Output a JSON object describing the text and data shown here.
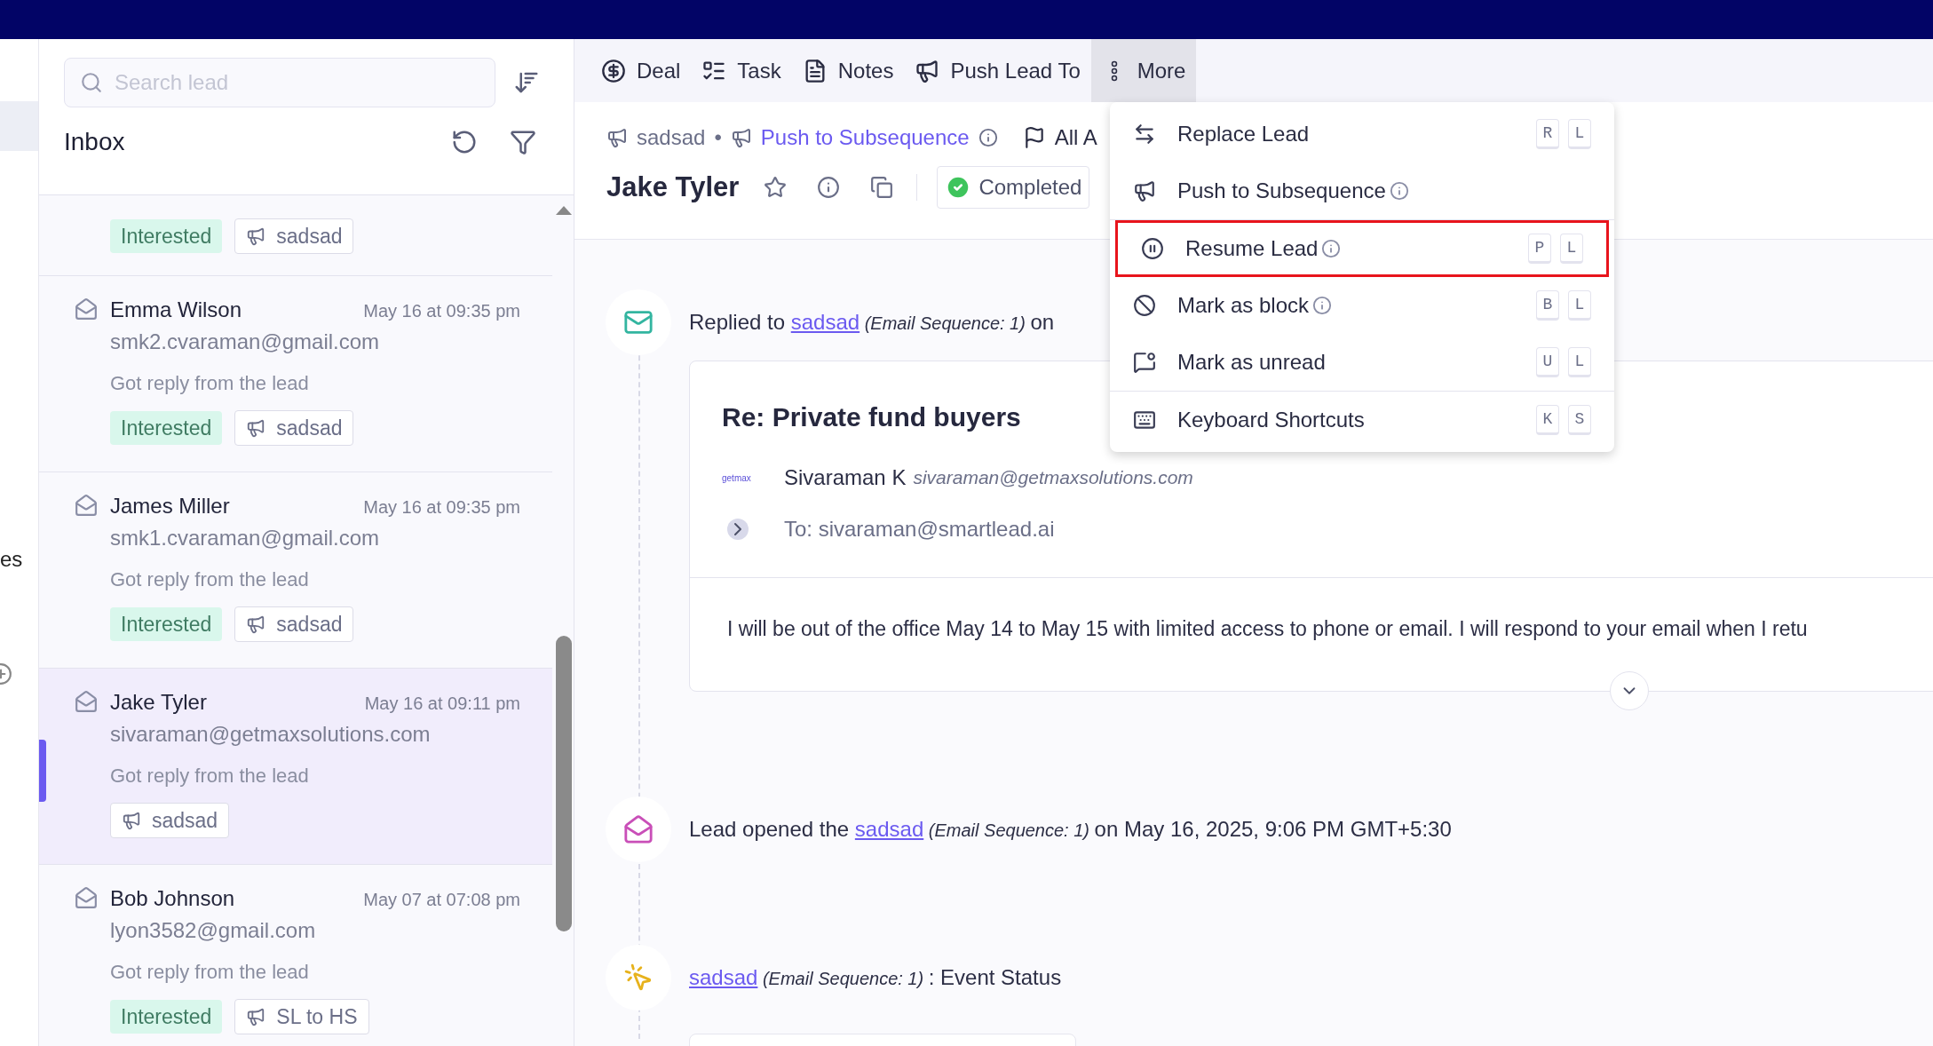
{
  "side_strip": {
    "label": "es"
  },
  "lead_list": {
    "search": {
      "placeholder": "Search lead"
    },
    "title": "Inbox",
    "items": [
      {
        "selected": false,
        "tags": [
          {
            "kind": "status",
            "label": "Interested"
          },
          {
            "kind": "campaign",
            "label": "sadsad"
          }
        ]
      },
      {
        "name": "Emma Wilson",
        "time": "May 16 at 09:35 pm",
        "email": "smk2.cvaraman@gmail.com",
        "preview": "Got reply from the lead",
        "selected": false,
        "tags": [
          {
            "kind": "status",
            "label": "Interested"
          },
          {
            "kind": "campaign",
            "label": "sadsad"
          }
        ]
      },
      {
        "name": "James Miller",
        "time": "May 16 at 09:35 pm",
        "email": "smk1.cvaraman@gmail.com",
        "preview": "Got reply from the lead",
        "selected": false,
        "tags": [
          {
            "kind": "status",
            "label": "Interested"
          },
          {
            "kind": "campaign",
            "label": "sadsad"
          }
        ]
      },
      {
        "name": "Jake Tyler",
        "time": "May 16 at 09:11 pm",
        "email": "sivaraman@getmaxsolutions.com",
        "preview": "Got reply from the lead",
        "selected": true,
        "tags": [
          {
            "kind": "campaign",
            "label": "sadsad"
          }
        ]
      },
      {
        "name": "Bob Johnson",
        "time": "May 07 at 07:08 pm",
        "email": "lyon3582@gmail.com",
        "preview": "Got reply from the lead",
        "selected": false,
        "tags": [
          {
            "kind": "status",
            "label": "Interested"
          },
          {
            "kind": "campaign",
            "label": "SL to HS"
          }
        ]
      }
    ]
  },
  "toolbar": [
    {
      "kind": "deal",
      "label": "Deal",
      "selected": false
    },
    {
      "kind": "task",
      "label": "Task",
      "selected": false
    },
    {
      "kind": "notes",
      "label": "Notes",
      "selected": false
    },
    {
      "kind": "push",
      "label": "Push Lead To",
      "selected": false
    },
    {
      "kind": "more",
      "label": "More",
      "selected": true
    }
  ],
  "lead_header": {
    "campaign": "sadsad",
    "separator": "•",
    "subsequence_link": "Push to Subsequence",
    "flag_label": "All A",
    "name": "Jake Tyler",
    "status": "Completed"
  },
  "menu": [
    {
      "kind": "replace",
      "label": "Replace Lead",
      "info": false,
      "keys": [
        "R",
        "L"
      ],
      "highlighted": false,
      "divider_before": false
    },
    {
      "kind": "push",
      "label": "Push to Subsequence",
      "info": true,
      "highlighted": false,
      "divider_before": false
    },
    {
      "kind": "resume",
      "label": "Resume Lead",
      "info": true,
      "keys": [
        "P",
        "L"
      ],
      "highlighted": true,
      "divider_before": true
    },
    {
      "kind": "block",
      "label": "Mark as block",
      "info": true,
      "keys": [
        "B",
        "L"
      ],
      "highlighted": false,
      "divider_before": false
    },
    {
      "kind": "unread",
      "label": "Mark as unread",
      "info": false,
      "keys": [
        "U",
        "L"
      ],
      "highlighted": false,
      "divider_before": false
    },
    {
      "kind": "shortcuts",
      "label": "Keyboard Shortcuts",
      "info": false,
      "keys": [
        "K",
        "S"
      ],
      "highlighted": false,
      "divider_before": true
    }
  ],
  "timeline": [
    {
      "kind": "reply",
      "prefix": "Replied to",
      "link": "sadsad",
      "note": "(Email Sequence: 1)",
      "suffix": "on",
      "email": {
        "subject": "Re: Private fund buyers",
        "sender_logo": "getmax",
        "sender_name": "Sivaraman K",
        "sender_email": "sivaraman@getmaxsolutions.com",
        "to": "To: sivaraman@smartlead.ai",
        "body": "I will be out of the office May 14 to May 15 with limited access to phone or email. I will respond to your email when I retu"
      }
    },
    {
      "kind": "opened",
      "prefix": "Lead opened the",
      "link": "sadsad",
      "note": "(Email Sequence: 1)",
      "suffix": "on May 16, 2025, 9:06 PM GMT+5:30"
    },
    {
      "kind": "status",
      "link": "sadsad",
      "note": "(Email Sequence: 1)",
      "suffix": ": Event Status"
    }
  ]
}
